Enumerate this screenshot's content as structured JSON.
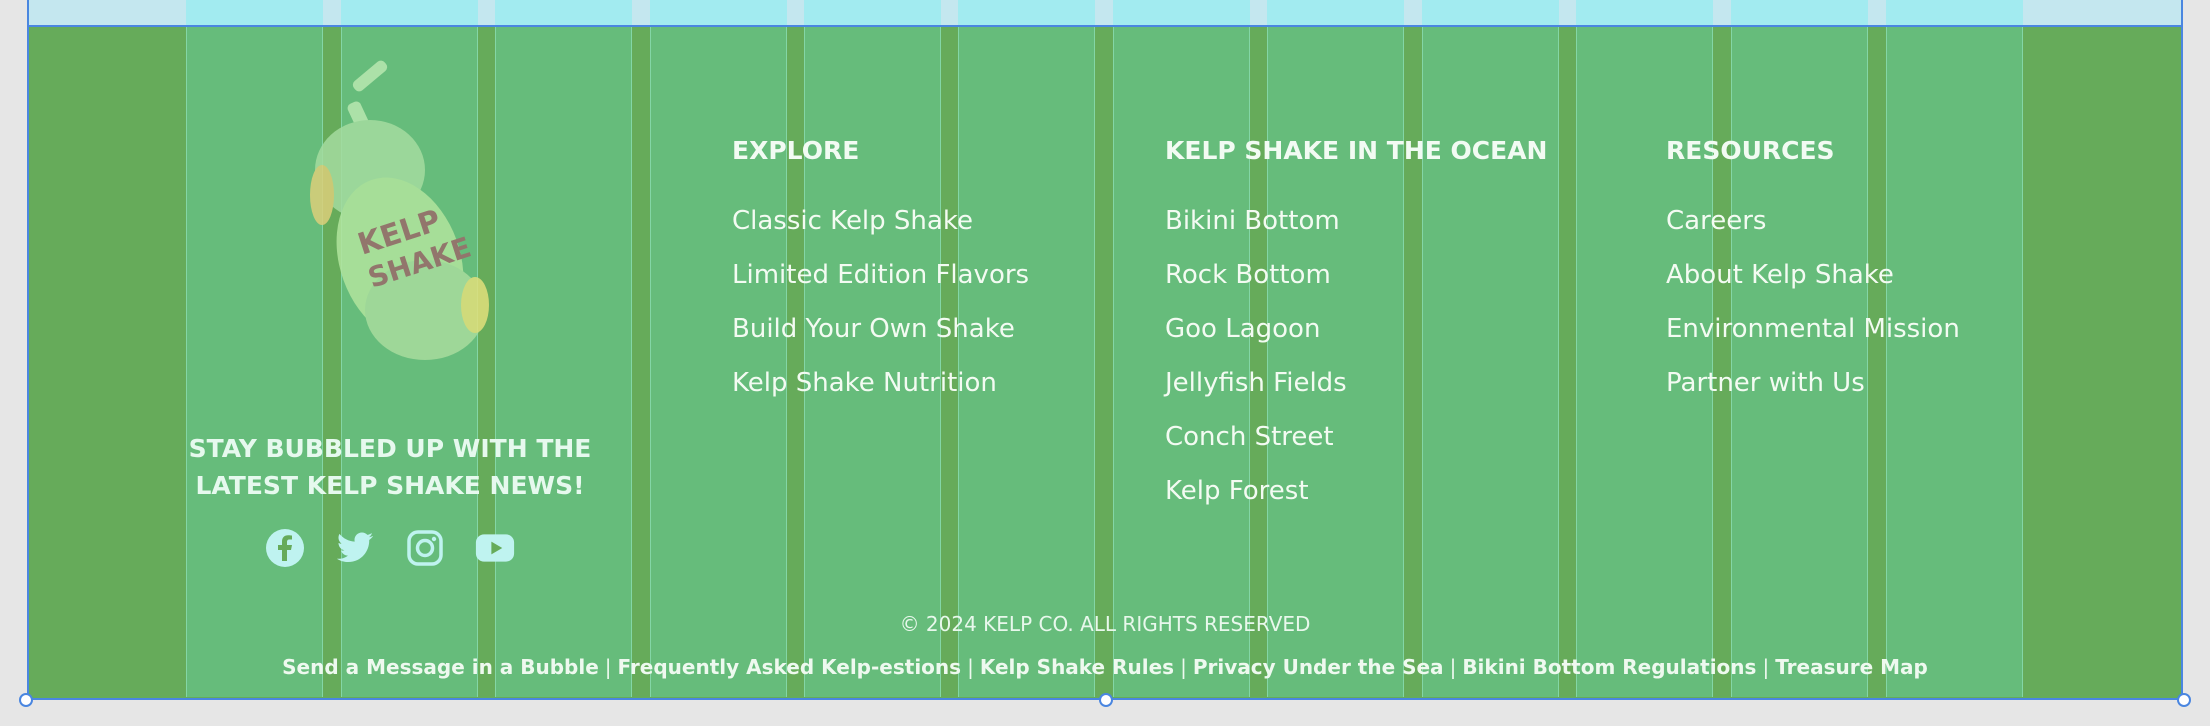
{
  "brand": {
    "logo_lettering": "KELP SHAKE",
    "tagline": "STAY BUBBLED UP WITH THE LATEST KELP SHAKE NEWS!"
  },
  "social": [
    {
      "icon": "facebook-icon",
      "label": "Facebook"
    },
    {
      "icon": "twitter-icon",
      "label": "Twitter"
    },
    {
      "icon": "instagram-icon",
      "label": "Instagram"
    },
    {
      "icon": "youtube-icon",
      "label": "YouTube"
    }
  ],
  "columns": [
    {
      "heading": "EXPLORE",
      "links": [
        "Classic Kelp Shake",
        "Limited Edition Flavors",
        "Build Your Own Shake",
        "Kelp Shake Nutrition"
      ]
    },
    {
      "heading": "KELP SHAKE IN THE OCEAN",
      "links": [
        "Bikini Bottom",
        "Rock Bottom",
        "Goo Lagoon",
        "Jellyfish Fields",
        "Conch Street",
        "Kelp Forest"
      ]
    },
    {
      "heading": "RESOURCES",
      "links": [
        "Careers",
        "About Kelp Shake",
        "Environmental Mission",
        "Partner with Us"
      ]
    }
  ],
  "footer": {
    "copyright": "© 2024 KELP CO. ALL RIGHTS RESERVED",
    "legal_links": [
      "Send a Message in a Bubble",
      "Frequently Asked Kelp-estions",
      "Kelp Shake Rules",
      "Privacy Under the Sea",
      "Bikini Bottom Regulations",
      "Treasure Map"
    ],
    "separator": "|"
  },
  "colors": {
    "background": "#66ab5a",
    "grid_overlay": "#66d3aa",
    "selection": "#4a86e0",
    "text": "#f3fbf2"
  }
}
